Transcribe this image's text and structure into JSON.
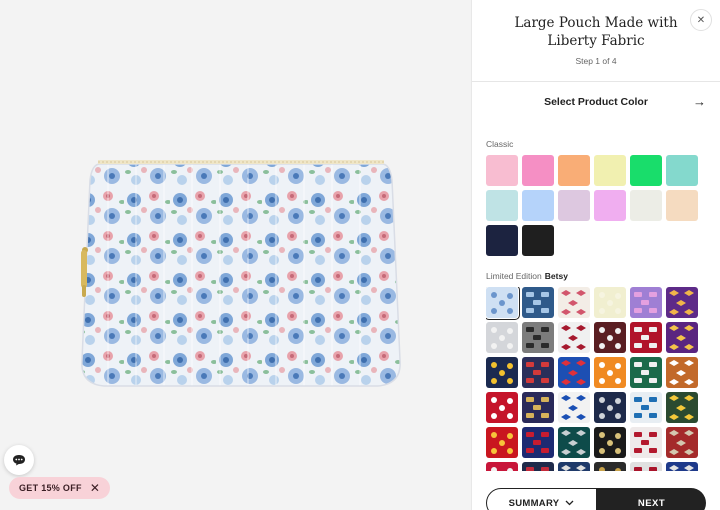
{
  "product": {
    "title": "Large Pouch Made with Liberty Fabric",
    "step": "Step 1 of 4"
  },
  "select": {
    "heading": "Select Product Color"
  },
  "classic": {
    "label": "Classic",
    "colors": [
      "#f8bdd1",
      "#f58fc4",
      "#f9ad76",
      "#f1f0b0",
      "#19dd6b",
      "#84d9cd",
      "#bfe3e5",
      "#b5d3fa",
      "#ddc8e0",
      "#f0aef0",
      "#ecede6",
      "#f5dbc0",
      "#1c2340",
      "#1f1f1f"
    ]
  },
  "limited": {
    "label": "Limited Edition",
    "selected_name": "Betsy",
    "patterns": [
      {
        "bg": "#cfe0f3",
        "fg": "#6b95cc"
      },
      {
        "bg": "#2f5a8a",
        "fg": "#a6c6e6"
      },
      {
        "bg": "#f3ede6",
        "fg": "#d2566c"
      },
      {
        "bg": "#f1efd0",
        "fg": "#f6f4e0"
      },
      {
        "bg": "#9f7fd4",
        "fg": "#e4a0e0"
      },
      {
        "bg": "#5d2a88",
        "fg": "#f0b54a"
      },
      {
        "bg": "#d4d6da",
        "fg": "#f2f2f2"
      },
      {
        "bg": "#7c7c7c",
        "fg": "#2a2a2a"
      },
      {
        "bg": "#f0f0f0",
        "fg": "#a6192e"
      },
      {
        "bg": "#5a1e22",
        "fg": "#f0f0f0"
      },
      {
        "bg": "#b1142b",
        "fg": "#f0f0f0"
      },
      {
        "bg": "#5a2580",
        "fg": "#f3c34a"
      },
      {
        "bg": "#1b2a50",
        "fg": "#f2c12e"
      },
      {
        "bg": "#2b2f5a",
        "fg": "#d33a3a"
      },
      {
        "bg": "#1d4fb3",
        "fg": "#e0313a"
      },
      {
        "bg": "#f08a22",
        "fg": "#ffffff"
      },
      {
        "bg": "#1b6a4a",
        "fg": "#f0f0f0"
      },
      {
        "bg": "#c2692a",
        "fg": "#ffffff"
      },
      {
        "bg": "#c5142a",
        "fg": "#ffffff"
      },
      {
        "bg": "#2a2a5a",
        "fg": "#d6b25a"
      },
      {
        "bg": "#f2f2f2",
        "fg": "#1a4fb4"
      },
      {
        "bg": "#1e2a4a",
        "fg": "#d0d4da"
      },
      {
        "bg": "#e8eef3",
        "fg": "#1f6fb4"
      },
      {
        "bg": "#2b4a30",
        "fg": "#f3c83a"
      },
      {
        "bg": "#c9161f",
        "fg": "#f7c33a"
      },
      {
        "bg": "#1d2a72",
        "fg": "#c71c30"
      },
      {
        "bg": "#0e4b4a",
        "fg": "#c8cfd2"
      },
      {
        "bg": "#1a1a1a",
        "fg": "#d8c17a"
      },
      {
        "bg": "#efeaea",
        "fg": "#b3192e"
      },
      {
        "bg": "#a42a2a",
        "fg": "#d4c8b0"
      },
      {
        "bg": "#c8163a",
        "fg": "#f2f2f2"
      },
      {
        "bg": "#1f2a4a",
        "fg": "#c42a3a"
      },
      {
        "bg": "#1f3a6a",
        "fg": "#e0e0e0"
      },
      {
        "bg": "#2a2a2a",
        "fg": "#c8a24a"
      },
      {
        "bg": "#e0e0e0",
        "fg": "#a9142b"
      },
      {
        "bg": "#1e3a8a",
        "fg": "#e3e3e3"
      }
    ]
  },
  "promo": {
    "label": "GET 15% OFF"
  },
  "footer": {
    "summary_label": "SUMMARY",
    "next_label": "NEXT"
  }
}
